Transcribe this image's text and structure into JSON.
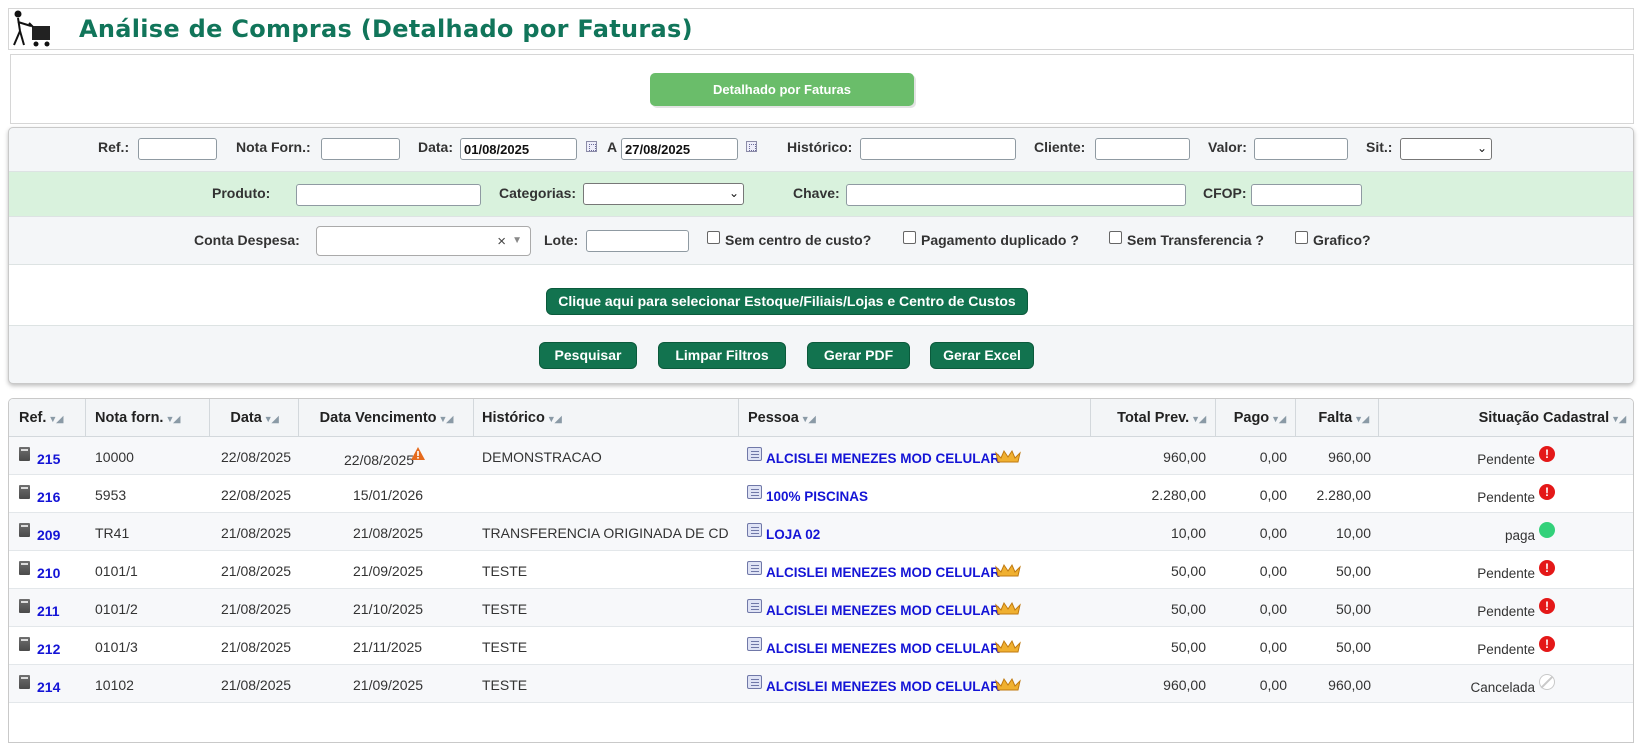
{
  "page": {
    "title": "Análise de Compras (Detalhado por Faturas)"
  },
  "mode_button": "Detalhado por Faturas",
  "filters": {
    "ref_label": "Ref.:",
    "nota_label": "Nota Forn.:",
    "data_label": "Data:",
    "data_from": "01/08/2025",
    "a_label": "A",
    "data_to": "27/08/2025",
    "historico_label": "Histórico:",
    "cliente_label": "Cliente:",
    "valor_label": "Valor:",
    "sit_label": "Sit.:",
    "produto_label": "Produto:",
    "categorias_label": "Categorias:",
    "chave_label": "Chave:",
    "cfop_label": "CFOP:",
    "conta_label": "Conta Despesa:",
    "lote_label": "Lote:",
    "sem_centro": "Sem centro de custo?",
    "pag_dup": "Pagamento duplicado ?",
    "sem_transf": "Sem Transferencia ?",
    "grafico": "Grafico?"
  },
  "buttons": {
    "select_estoque": "Clique aqui para selecionar Estoque/Filiais/Lojas e Centro de Custos",
    "pesquisar": "Pesquisar",
    "limpar": "Limpar Filtros",
    "pdf": "Gerar PDF",
    "excel": "Gerar Excel"
  },
  "table": {
    "headers": [
      "Ref.",
      "Nota forn.",
      "Data",
      "Data Vencimento",
      "Histórico",
      "Pessoa",
      "Total Prev.",
      "Pago",
      "Falta",
      "Situação Cadastral"
    ],
    "rows": [
      {
        "ref": "215",
        "nota": "10000",
        "data": "22/08/2025",
        "venc": "22/08/2025",
        "hist": "DEMONSTRACAO",
        "pessoa": "ALCISLEI MENEZES MOD CELULAR",
        "total": "960,00",
        "pago": "0,00",
        "falta": "960,00",
        "sit": "Pendente",
        "status": "pending",
        "warn": true,
        "crown": true
      },
      {
        "ref": "216",
        "nota": "5953",
        "data": "22/08/2025",
        "venc": "15/01/2026",
        "hist": "",
        "pessoa": "100% PISCINAS",
        "total": "2.280,00",
        "pago": "0,00",
        "falta": "2.280,00",
        "sit": "Pendente",
        "status": "pending",
        "warn": false,
        "crown": false
      },
      {
        "ref": "209",
        "nota": "TR41",
        "data": "21/08/2025",
        "venc": "21/08/2025",
        "hist": "TRANSFERENCIA ORIGINADA DE CD",
        "pessoa": "LOJA 02",
        "total": "10,00",
        "pago": "0,00",
        "falta": "10,00",
        "sit": "paga",
        "status": "paid",
        "warn": false,
        "crown": false
      },
      {
        "ref": "210",
        "nota": "0101/1",
        "data": "21/08/2025",
        "venc": "21/09/2025",
        "hist": "TESTE",
        "pessoa": "ALCISLEI MENEZES MOD CELULAR",
        "total": "50,00",
        "pago": "0,00",
        "falta": "50,00",
        "sit": "Pendente",
        "status": "pending",
        "warn": false,
        "crown": true
      },
      {
        "ref": "211",
        "nota": "0101/2",
        "data": "21/08/2025",
        "venc": "21/10/2025",
        "hist": "TESTE",
        "pessoa": "ALCISLEI MENEZES MOD CELULAR",
        "total": "50,00",
        "pago": "0,00",
        "falta": "50,00",
        "sit": "Pendente",
        "status": "pending",
        "warn": false,
        "crown": true
      },
      {
        "ref": "212",
        "nota": "0101/3",
        "data": "21/08/2025",
        "venc": "21/11/2025",
        "hist": "TESTE",
        "pessoa": "ALCISLEI MENEZES MOD CELULAR",
        "total": "50,00",
        "pago": "0,00",
        "falta": "50,00",
        "sit": "Pendente",
        "status": "pending",
        "warn": false,
        "crown": true
      },
      {
        "ref": "214",
        "nota": "10102",
        "data": "21/08/2025",
        "venc": "21/09/2025",
        "hist": "TESTE",
        "pessoa": "ALCISLEI MENEZES MOD CELULAR",
        "total": "960,00",
        "pago": "0,00",
        "falta": "960,00",
        "sit": "Cancelada",
        "status": "cancelled",
        "warn": false,
        "crown": true
      }
    ]
  },
  "colors": {
    "brand_green": "#11755a",
    "button_green": "#12734f",
    "mode_button": "#6abd6a",
    "link_blue": "#1414d6"
  }
}
